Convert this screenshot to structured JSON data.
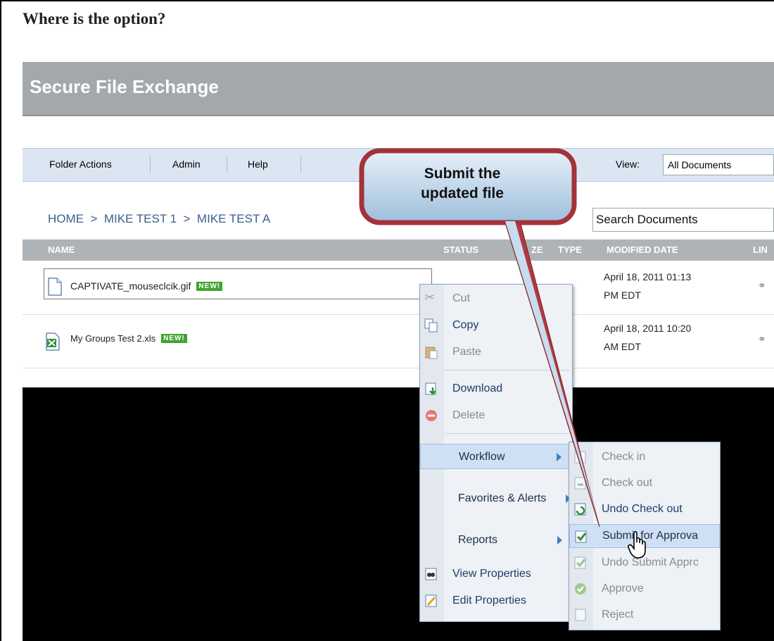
{
  "question": "Where is the option?",
  "app": {
    "title": "Secure File Exchange"
  },
  "menubar": {
    "items": [
      "Folder Actions",
      "Admin",
      "Help"
    ],
    "view_label": "View:",
    "view_value": "All Documents"
  },
  "breadcrumb": "HOME  >  MIKE TEST 1  >  MIKE TEST A",
  "search": {
    "value": "Search Documents"
  },
  "columns": [
    "NAME",
    "STATUS",
    "ZE",
    "TYPE",
    "MODIFIED DATE",
    "LIN"
  ],
  "files": [
    {
      "name": "CAPTIVATE_mouseclcik.gif",
      "badge": "NEW!",
      "date_line1": "April 18, 2011 01:13",
      "date_line2": "PM EDT",
      "icon": "document-icon"
    },
    {
      "name": "My Groups Test 2.xls",
      "badge": "NEW!",
      "date_line1": "April 18, 2011 10:20",
      "date_line2": "AM EDT",
      "icon": "excel-icon"
    }
  ],
  "context_menu": {
    "items": [
      {
        "label": "Cut",
        "enabled": false,
        "icon": "scissors-icon"
      },
      {
        "label": "Copy",
        "enabled": true,
        "icon": "copy-icon"
      },
      {
        "label": "Paste",
        "enabled": false,
        "icon": "paste-icon"
      },
      {
        "label": "Download",
        "enabled": true,
        "icon": "download-icon"
      },
      {
        "label": "Delete",
        "enabled": false,
        "icon": "delete-icon"
      },
      {
        "label": "Workflow",
        "enabled": true,
        "submenu": true
      },
      {
        "label": "Favorites & Alerts",
        "enabled": true,
        "submenu": true
      },
      {
        "label": "Reports",
        "enabled": true,
        "submenu": true
      },
      {
        "label": "View Properties",
        "enabled": true,
        "icon": "view-properties-icon"
      },
      {
        "label": "Edit Properties",
        "enabled": true,
        "icon": "edit-properties-icon"
      }
    ]
  },
  "workflow_menu": {
    "items": [
      {
        "label": "Check in",
        "enabled": false,
        "icon": "check-in-icon"
      },
      {
        "label": "Check out",
        "enabled": false,
        "icon": "check-out-icon"
      },
      {
        "label": "Undo Check out",
        "enabled": true,
        "icon": "undo-checkout-icon"
      },
      {
        "label": "Submit for Approva",
        "enabled": true,
        "highlighted": true,
        "icon": "submit-approval-icon"
      },
      {
        "label": "Undo Submit Apprc",
        "enabled": false,
        "icon": "undo-submit-icon"
      },
      {
        "label": "Approve",
        "enabled": false,
        "icon": "approve-icon"
      },
      {
        "label": "Reject",
        "enabled": false,
        "icon": "reject-icon"
      }
    ]
  },
  "callout": {
    "line1": "Submit the",
    "line2": "updated file"
  },
  "colors": {
    "titlebar": "#a4a8ab",
    "menubar": "#dce6f3",
    "callout_border": "#a4323a",
    "callout_fill": "#c8dcef",
    "new_badge": "#43a32f"
  }
}
